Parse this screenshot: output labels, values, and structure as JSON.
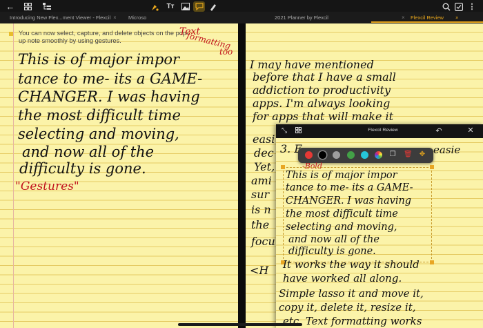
{
  "tabs": [
    {
      "label": "Introducing New Flex...ment Viewer - Flexcil",
      "close": "×"
    },
    {
      "label": "Microso",
      "close": ""
    },
    {
      "label": "2021 Planner by Flexcil",
      "close": "×"
    },
    {
      "label": "Flexcil Review",
      "close": "×"
    }
  ],
  "left_note": {
    "tip": "You can now select, capture, and delete objects on the pop-up note smoothly by using gestures.",
    "handwriting": [
      "This is of major impor",
      "tance to me- its a GAME-",
      "CHANGER. I was having",
      "the most difficult time",
      "selecting and moving,",
      "and now all of the",
      "difficulty is gone."
    ],
    "red_annotation": "\"Gestures\"",
    "red_margin_note": [
      "Text",
      "formatting",
      "too"
    ]
  },
  "right_note": {
    "handwriting": [
      "I may have mentioned",
      "before that I have a small",
      "addiction to productivity",
      "apps. I'm always looking",
      "for apps that will make it",
      "easi",
      "dec",
      "Yet,",
      "ami",
      "sur",
      "is n",
      "the",
      "focu",
      "<H"
    ],
    "popup_partial_line": "3. E",
    "popup_partial_tail": "easie",
    "bold_label": "-Bold"
  },
  "popup": {
    "title": "Flexcil Review",
    "selection_text": [
      "This is of major impor",
      "tance to me- its a GAME-",
      "CHANGER. I was having",
      "the most difficult time",
      "selecting and moving,",
      "and now all of the",
      "difficulty is gone."
    ],
    "continued_text": [
      "It works the way it should",
      "have worked all along.",
      "Simple lasso it and move it,",
      "copy it, delete it, resize it,",
      "etc. Text formatting works"
    ]
  },
  "colors": {
    "accent": "#e7a61c",
    "paper": "#fbf3a9",
    "ink_red": "#c1121c",
    "swatches": [
      "#e53935",
      "#000000",
      "#9e9e9e",
      "#43a047",
      "#26c6da"
    ]
  },
  "icons": {
    "top_left": [
      "back-arrow",
      "grid",
      "file-tree"
    ],
    "left_tools": [
      "pen-tool",
      "text-tool",
      "image-tool",
      "comment-tool",
      "pencil-tool"
    ],
    "top_right": [
      "search",
      "checklist",
      "more"
    ],
    "popup": [
      "collapse",
      "grid",
      "undo",
      "close"
    ]
  }
}
